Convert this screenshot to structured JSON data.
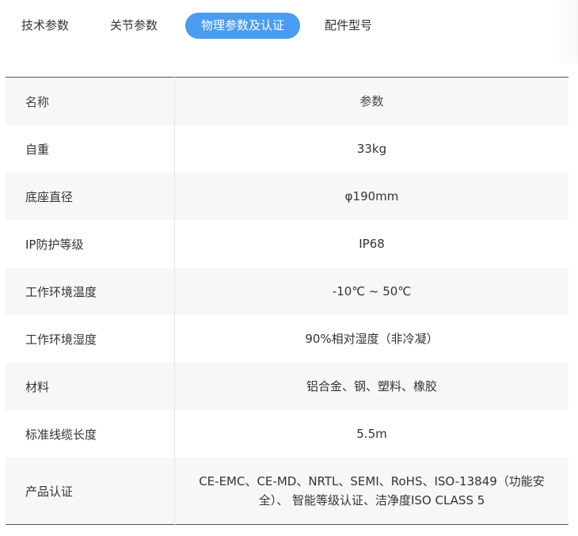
{
  "tabs": [
    {
      "label": "技术参数",
      "active": false
    },
    {
      "label": "关节参数",
      "active": false
    },
    {
      "label": "物理参数及认证",
      "active": true
    },
    {
      "label": "配件型号",
      "active": false
    }
  ],
  "table": {
    "header": {
      "name": "名称",
      "value": "参数"
    },
    "rows": [
      {
        "name": "自重",
        "value": "33kg"
      },
      {
        "name": "底座直径",
        "value": "φ190mm"
      },
      {
        "name": "IP防护等级",
        "value": "IP68"
      },
      {
        "name": "工作环境温度",
        "value": "-10℃ ~ 50℃"
      },
      {
        "name": "工作环境湿度",
        "value": "90%相对湿度（非冷凝）"
      },
      {
        "name": "材料",
        "value": "铝合金、钢、塑料、橡胶"
      },
      {
        "name": "标准线缆长度",
        "value": "5.5m"
      },
      {
        "name": "产品认证",
        "value": "CE-EMC、CE-MD、NRTL、SEMI、RoHS、ISO-13849（功能安全）、 智能等级认证、洁净度ISO CLASS 5"
      }
    ]
  },
  "colors": {
    "active_tab": "#4a9cf1",
    "shaded_row": "#f7f7f8",
    "text": "#333333"
  }
}
